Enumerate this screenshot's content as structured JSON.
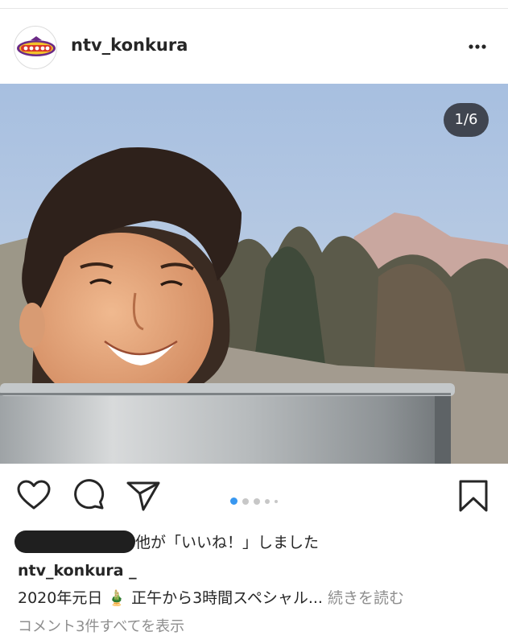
{
  "post": {
    "username": "ntv_konkura",
    "media_counter": "1/6",
    "carousel_total": 5,
    "carousel_active": 1,
    "likes_text": "他が「いいね！」しました",
    "caption_username": "ntv_konkura _",
    "caption_text": "2020年元日 🎍 正午から3時間スペシャル...",
    "caption_more": "続きを読む",
    "view_comments": "コメント3件すべてを表示"
  },
  "colors": {
    "text": "#262626",
    "secondary_text": "#8e8e8e",
    "active_dot": "#3897f0",
    "inactive_dot": "#c7c7c7"
  },
  "icons": {
    "more": "more-horizontal-icon",
    "like": "heart-icon",
    "comment": "comment-bubble-icon",
    "share": "paper-plane-icon",
    "save": "bookmark-icon",
    "avatar": "show-logo-avatar"
  }
}
